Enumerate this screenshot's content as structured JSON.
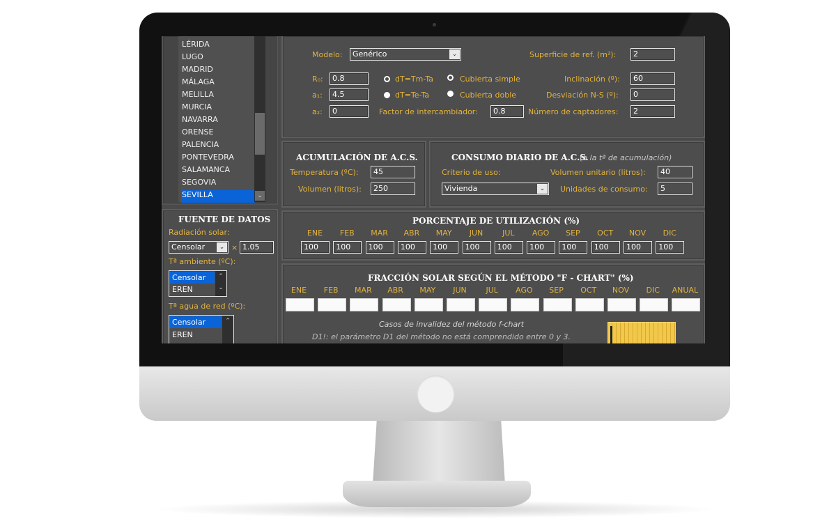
{
  "city_list": {
    "items": [
      "LÉRIDA",
      "LUGO",
      "MADRID",
      "MÁLAGA",
      "MELILLA",
      "MURCIA",
      "NAVARRA",
      "ORENSE",
      "PALENCIA",
      "PONTEVEDRA",
      "SALAMANCA",
      "SEGOVIA",
      "SEVILLA"
    ],
    "selected": "SEVILLA"
  },
  "collector": {
    "modelo_label": "Modelo:",
    "modelo_value": "Genérico",
    "superficie_label": "Superficie de ref. (m²):",
    "superficie_value": "2",
    "r0_label": "R₀:",
    "r0_value": "0.8",
    "a1_label": "a₁:",
    "a1_value": "4.5",
    "a2_label": "a₂:",
    "a2_value": "0",
    "dt1_label": "dT=Tm-Ta",
    "dt2_label": "dT=Te-Ta",
    "cub1_label": "Cubierta simple",
    "cub2_label": "Cubierta doble",
    "factor_label": "Factor de intercambiador:",
    "factor_value": "0.8",
    "inclinacion_label": "Inclinación (º):",
    "inclinacion_value": "60",
    "desviacion_label": "Desviación N-S (º):",
    "desviacion_value": "0",
    "numero_label": "Número de captadores:",
    "numero_value": "2"
  },
  "acumulacion": {
    "title": "ACUMULACIÓN DE A.C.S.",
    "temp_label": "Temperatura (ºC):",
    "temp_value": "45",
    "vol_label": "Volumen (litros):",
    "vol_value": "250"
  },
  "consumo": {
    "title": "CONSUMO DIARIO DE A.C.S.",
    "title_note": "(a la tª de acumulación)",
    "criterio_label": "Criterio de uso:",
    "criterio_value": "Vivienda",
    "vol_unit_label": "Volumen unitario (litros):",
    "vol_unit_value": "40",
    "unidades_label": "Unidades de consumo:",
    "unidades_value": "5"
  },
  "fuente": {
    "title": "FUENTE DE DATOS",
    "radiacion_label": "Radiación solar:",
    "radiacion_value": "Censolar",
    "mult_symbol": "×",
    "mult_value": "1.05",
    "tamb_label": "Tª ambiente (ºC):",
    "tamb_options": [
      "Censolar",
      "EREN"
    ],
    "tred_label": "Tª agua de red (ºC):",
    "tred_options": [
      "Censolar",
      "EREN"
    ]
  },
  "utilizacion": {
    "title": "PORCENTAJE DE UTILIZACIÓN (%)",
    "months": [
      "ENE",
      "FEB",
      "MAR",
      "ABR",
      "MAY",
      "JUN",
      "JUL",
      "AGO",
      "SEP",
      "OCT",
      "NOV",
      "DIC"
    ],
    "values": [
      "100",
      "100",
      "100",
      "100",
      "100",
      "100",
      "100",
      "100",
      "100",
      "100",
      "100",
      "100"
    ]
  },
  "fchart": {
    "title": "FRACCIÓN SOLAR SEGÚN EL MÉTODO \"F - CHART\" (%)",
    "months": [
      "ENE",
      "FEB",
      "MAR",
      "ABR",
      "MAY",
      "JUN",
      "JUL",
      "AGO",
      "SEP",
      "OCT",
      "NOV",
      "DIC",
      "ANUAL"
    ],
    "casos_title": "Casos de invalidez del método f-chart",
    "d1_note": "D1!:   el parámetro D1 del método no está comprendido entre 0 y 3."
  },
  "colors": {
    "label": "#e2b33e",
    "panel": "#4d4d4d",
    "selection": "#0a64d8"
  }
}
